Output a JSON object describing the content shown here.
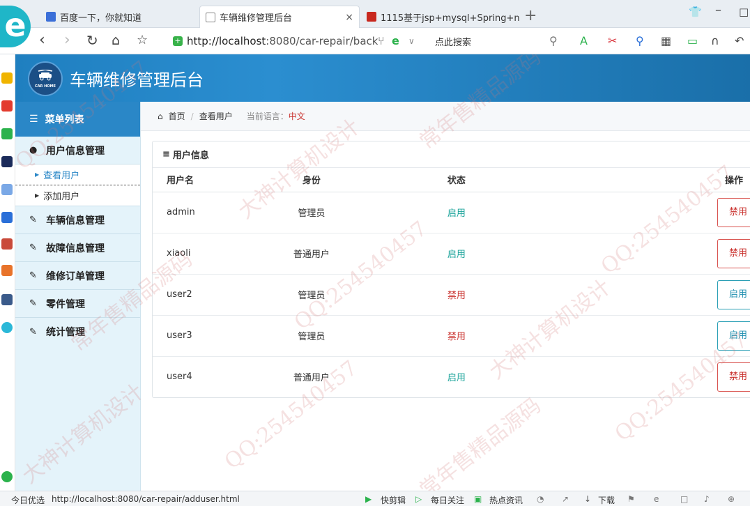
{
  "browser": {
    "tabs": [
      {
        "label": "百度一下，你就知道",
        "active": false
      },
      {
        "label": "车辆维修管理后台",
        "active": true
      },
      {
        "label": "1115基于jsp+mysql+Spring+n",
        "active": false
      }
    ],
    "tab_close": "×",
    "new_tab": "+",
    "url_host": "http://localhost",
    "url_rest": ":8080/car-repair/back",
    "search_placeholder": "点此搜索",
    "status": {
      "left_label": "今日优选",
      "hover_url": "http://localhost:8080/car-repair/adduser.html",
      "items": [
        "快剪辑",
        "每日关注",
        "热点资讯",
        "下载"
      ]
    }
  },
  "app": {
    "title": "车辆维修管理后台",
    "logo_text": "CAR HOME"
  },
  "sidebar": {
    "header": "菜单列表",
    "groups": [
      {
        "label": "用户信息管理",
        "icon": "user-icon",
        "children": [
          {
            "label": "查看用户",
            "active": true
          },
          {
            "label": "添加用户",
            "active": false
          }
        ]
      },
      {
        "label": "车辆信息管理",
        "icon": "edit-icon"
      },
      {
        "label": "故障信息管理",
        "icon": "edit-icon"
      },
      {
        "label": "维修订单管理",
        "icon": "edit-icon"
      },
      {
        "label": "零件管理",
        "icon": "edit-icon"
      },
      {
        "label": "统计管理",
        "icon": "edit-icon"
      }
    ]
  },
  "breadcrumb": {
    "home": "首页",
    "current": "查看用户",
    "lang_label": "当前语言：",
    "lang_value": "中文"
  },
  "panel": {
    "title": "用户信息",
    "columns": [
      "用户名",
      "身份",
      "状态",
      "操作"
    ],
    "rows": [
      {
        "username": "admin",
        "role": "管理员",
        "status": "启用",
        "action": "禁用"
      },
      {
        "username": "xiaoli",
        "role": "普通用户",
        "status": "启用",
        "action": "禁用"
      },
      {
        "username": "user2",
        "role": "管理员",
        "status": "禁用",
        "action": "启用"
      },
      {
        "username": "user3",
        "role": "管理员",
        "status": "禁用",
        "action": "启用"
      },
      {
        "username": "user4",
        "role": "普通用户",
        "status": "启用",
        "action": "禁用"
      }
    ]
  },
  "colors": {
    "header_blue": "#2a87c7",
    "enabled_teal": "#1aa39a",
    "disabled_red": "#c9302c"
  },
  "watermark": [
    "QQ:254540457",
    "常年售精品源码",
    "大神计算机设计"
  ]
}
